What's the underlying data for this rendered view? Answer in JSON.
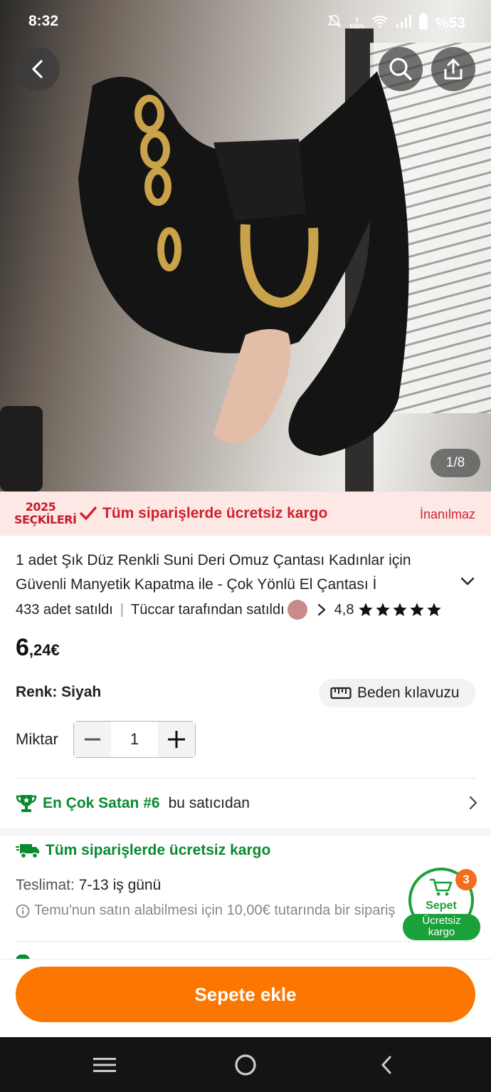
{
  "status_bar": {
    "time": "8:32",
    "net_speed_value": "5",
    "net_speed_unit": "KB/s",
    "battery": "%53"
  },
  "gallery": {
    "counter": "1/8"
  },
  "promo": {
    "badge_year": "2025",
    "badge_word": "SEÇKİLERİ",
    "text": "Tüm siparişlerde ücretsiz kargo",
    "right_text": "İnanılmaz"
  },
  "product": {
    "title": "1 adet Şık Düz Renkli Suni Deri Omuz Çantası Kadınlar için Güvenli Manyetik Kapatma ile - Çok Yönlü El Çantası İ",
    "sold": "433 adet satıldı",
    "seller": "Tüccar tarafından satıldı",
    "rating": "4,8",
    "stars": 5,
    "price_main": "6",
    "price_rest": ",24€"
  },
  "options": {
    "color_label": "Renk: Siyah",
    "size_guide": "Beden kılavuzu",
    "qty_label": "Miktar",
    "qty_value": "1"
  },
  "best_seller": {
    "highlight": "En Çok Satan #6",
    "rest": "bu satıcıdan"
  },
  "shipping": {
    "title": "Tüm siparişlerde ücretsiz kargo",
    "delivery_label": "Teslimat:",
    "delivery_value": "7-13 iş günü",
    "info": "Temu'nun satın alabilmesi için 10,00€ tutarında bir sipariş"
  },
  "cart_float": {
    "label": "Sepet",
    "count": "3",
    "free_line1": "Ücretsiz",
    "free_line2": "kargo"
  },
  "cta": {
    "add_to_cart": "Sepete ekle"
  },
  "colors": {
    "accent_orange": "#fb7701",
    "green": "#0a8a2e",
    "promo_red": "#d2202f",
    "promo_bg": "#fde8e6"
  }
}
